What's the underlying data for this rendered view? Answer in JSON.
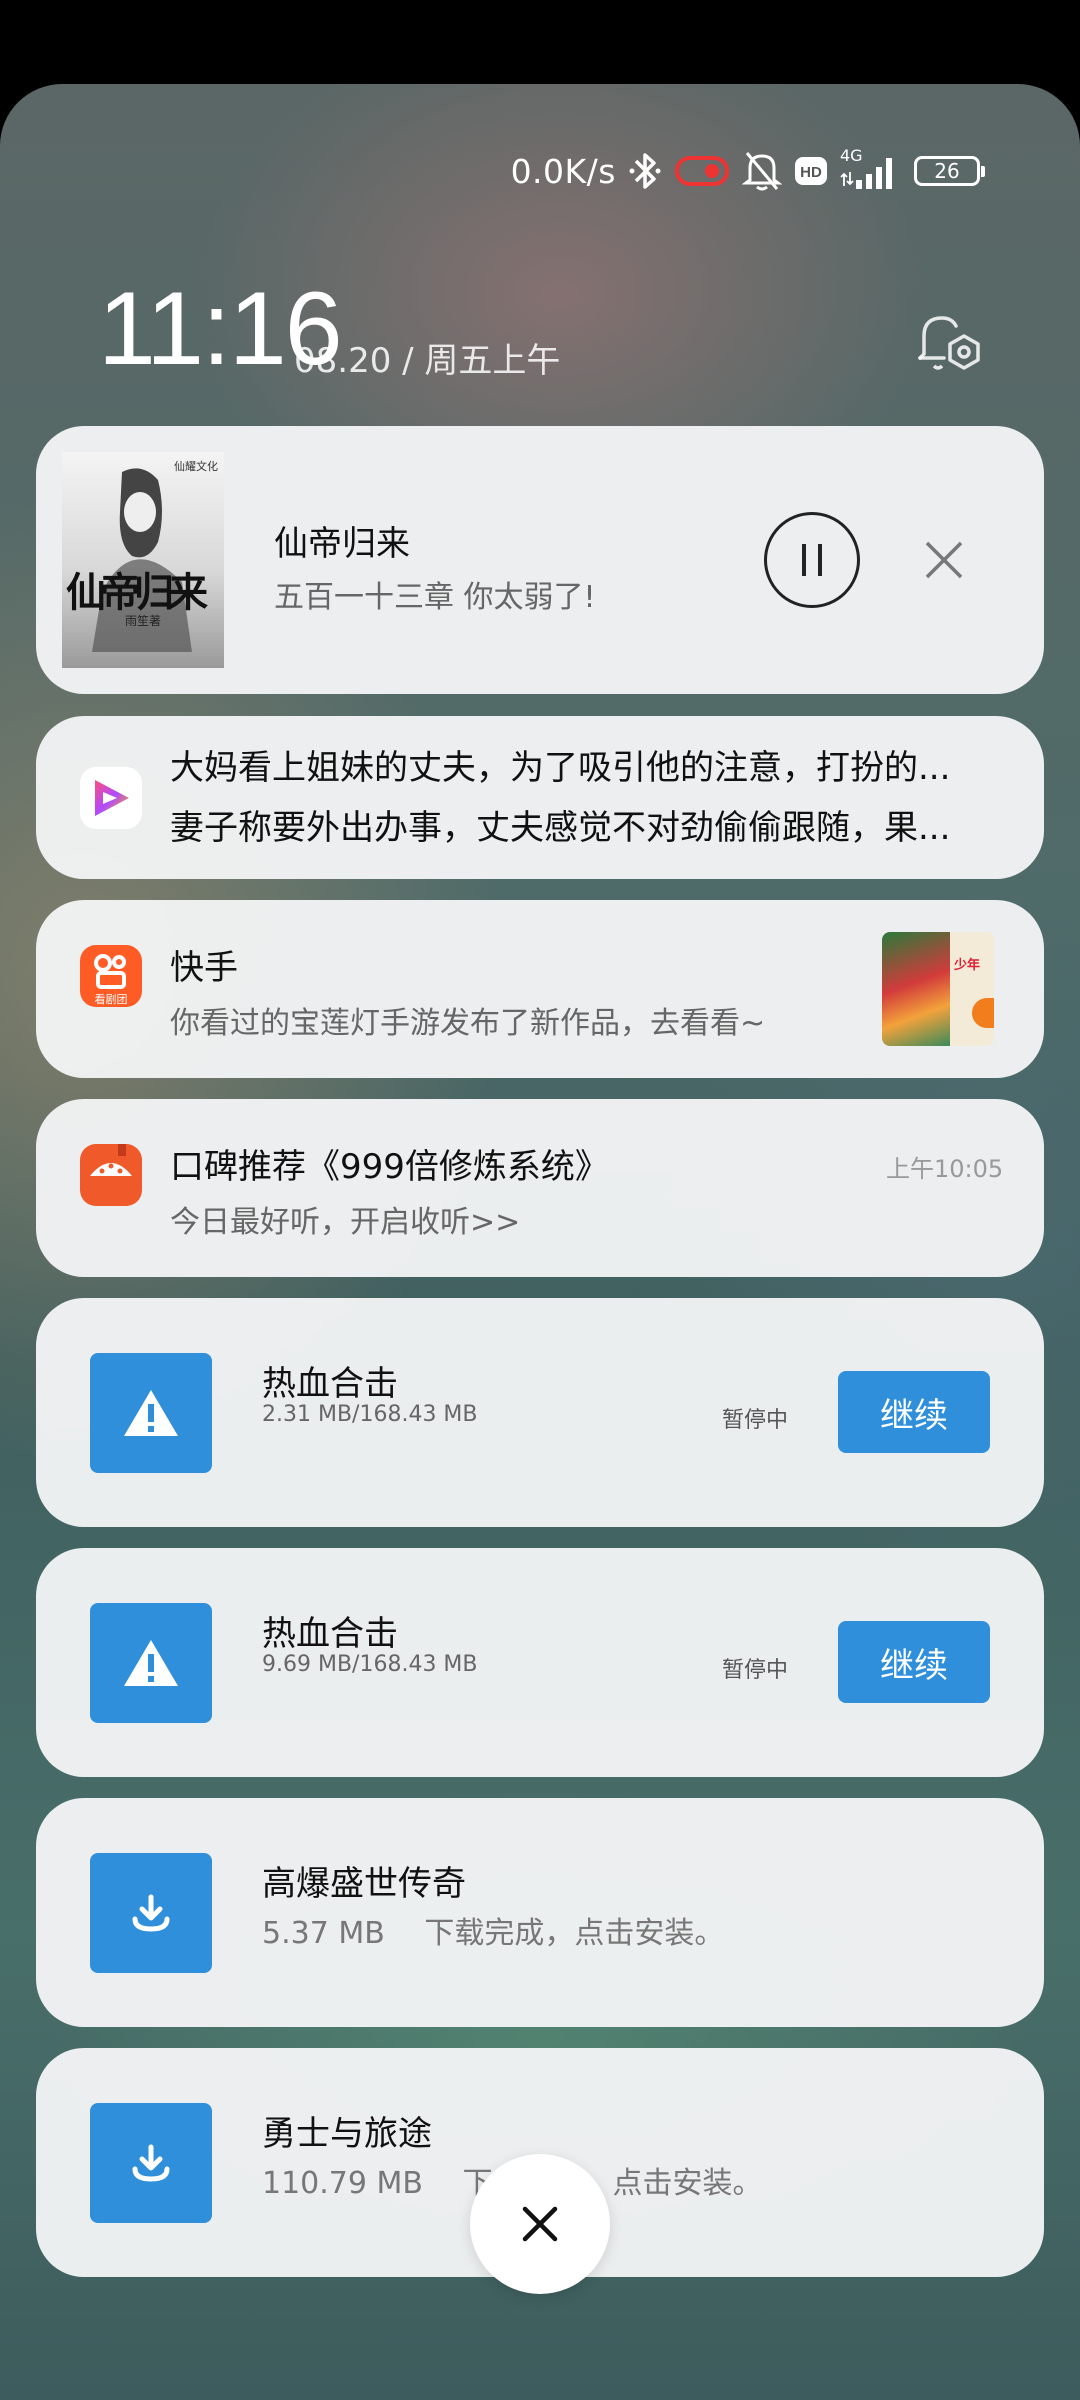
{
  "status_bar": {
    "net_speed": "0.0K/s",
    "signal_type": "4G",
    "hd_label": "HD",
    "battery_level": "26",
    "icons": [
      "bluetooth-icon",
      "mic-camera-indicator-icon",
      "mute-icon",
      "hd-icon",
      "signal-icon",
      "battery-icon"
    ]
  },
  "clock": {
    "time": "11:16",
    "date": "08.20 / 周五上午"
  },
  "media_card": {
    "cover_title": "仙帝归来",
    "cover_publisher": "仙耀文化",
    "cover_author": "雨笙著",
    "title": "仙帝归来",
    "subtitle": "五百一十三章  你太弱了!",
    "controls": [
      "pause-icon",
      "close-icon"
    ]
  },
  "video_notification": {
    "line1": "大妈看上姐妹的丈夫，为了吸引他的注意，打扮的...",
    "line2": "妻子称要外出办事，丈夫感觉不对劲偷偷跟随，果..."
  },
  "kuaishou_notification": {
    "app_name": "快手",
    "app_icon_caption": "看剧团",
    "text": "你看过的宝莲灯手游发布了新作品，去看看~",
    "thumb_text": "少年"
  },
  "radio_notification": {
    "title": "口碑推荐《999倍修炼系统》",
    "text": "今日最好听，开启收听>>",
    "time": "上午10:05"
  },
  "downloads": [
    {
      "title": "热血合击",
      "size": "2.31 MB/168.43 MB",
      "status": "暂停中",
      "button": "继续",
      "icon": "warning-icon"
    },
    {
      "title": "热血合击",
      "size": "9.69 MB/168.43 MB",
      "status": "暂停中",
      "button": "继续",
      "icon": "warning-icon"
    },
    {
      "title": "高爆盛世传奇",
      "size": "5.37 MB",
      "status": "下载完成，点击安装。",
      "icon": "download-icon"
    },
    {
      "title": "勇士与旅途",
      "size": "110.79 MB",
      "status": "下载完成，点击安装。",
      "icon": "download-icon"
    }
  ],
  "colors": {
    "accent": "#2f8fdb",
    "card": "#f2f4f5"
  }
}
